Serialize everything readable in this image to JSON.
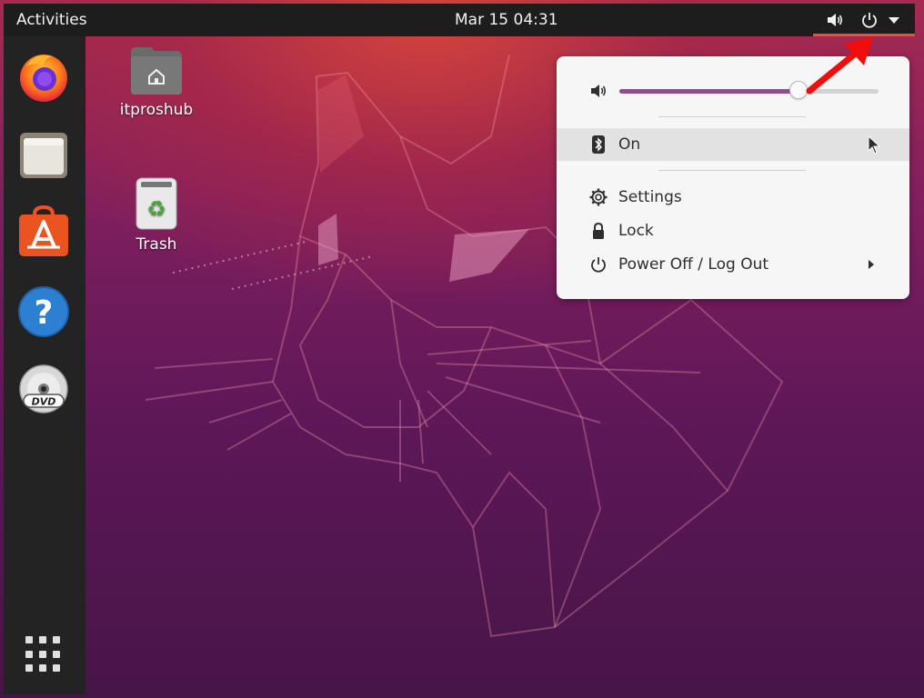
{
  "topbar": {
    "activities_label": "Activities",
    "clock": "Mar 15  04:31",
    "icons": [
      "volume-icon",
      "power-icon",
      "dropdown-arrow-icon"
    ]
  },
  "dock": {
    "items": [
      {
        "name": "Firefox",
        "icon": "firefox-icon"
      },
      {
        "name": "Files",
        "icon": "files-icon"
      },
      {
        "name": "Ubuntu Software",
        "icon": "software-store-icon"
      },
      {
        "name": "Help",
        "icon": "help-icon"
      },
      {
        "name": "DVD",
        "icon": "dvd-icon"
      }
    ],
    "show_apps_icon": "app-grid-icon"
  },
  "desktop_icons": [
    {
      "label": "itproshub",
      "icon": "home-folder-icon"
    },
    {
      "label": "Trash",
      "icon": "trash-icon"
    }
  ],
  "system_menu": {
    "volume": {
      "icon": "volume-icon",
      "level": 0.69
    },
    "bluetooth": {
      "icon": "bluetooth-icon",
      "label": "On"
    },
    "settings": {
      "icon": "gear-icon",
      "label": "Settings"
    },
    "lock": {
      "icon": "lock-icon",
      "label": "Lock"
    },
    "power": {
      "icon": "power-icon",
      "label": "Power Off / Log Out"
    }
  },
  "colors": {
    "accent_orange": "#e95420",
    "slider_fill": "#924d8b",
    "annotation_red": "#f20d0d",
    "topbar_bg": "#1d1d1d",
    "dock_bg": "#232323"
  }
}
